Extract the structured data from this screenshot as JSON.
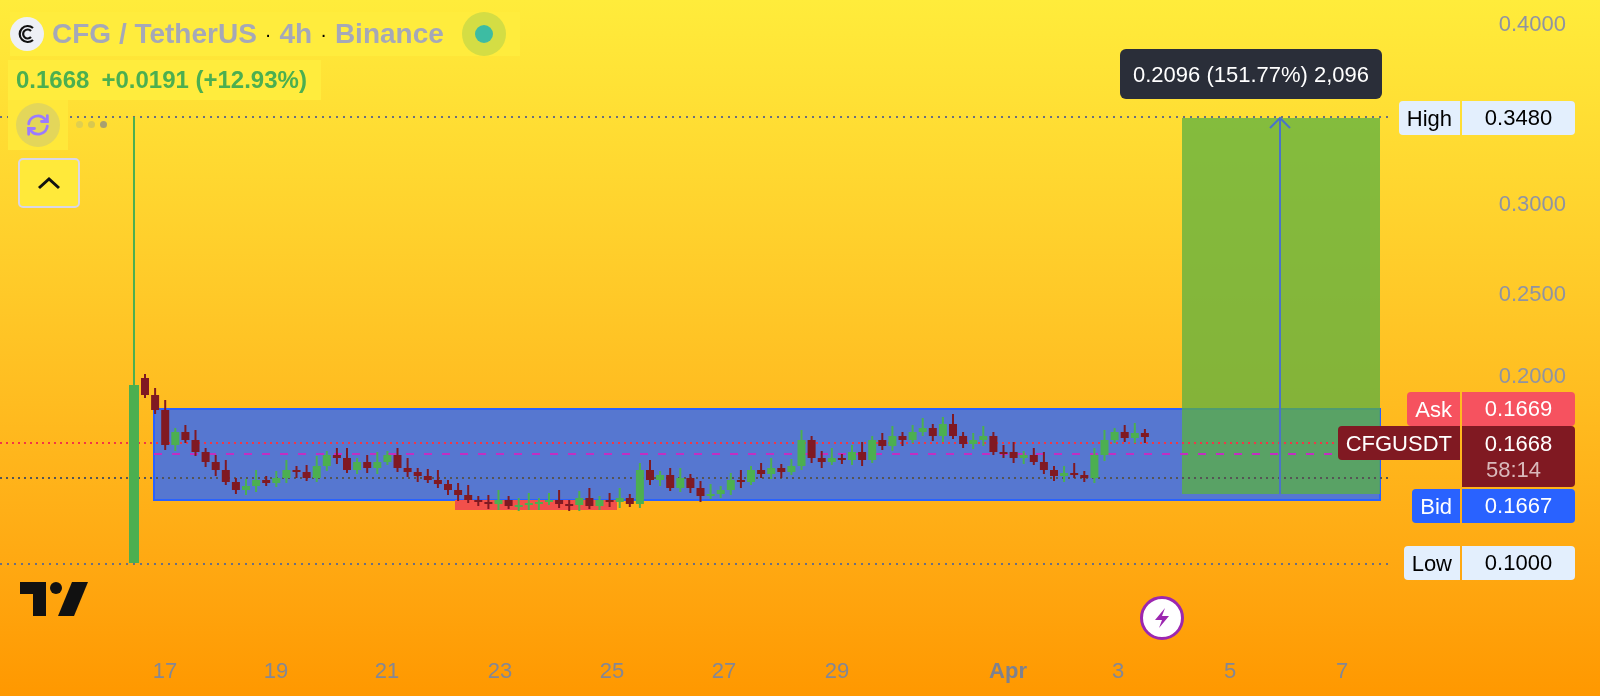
{
  "header": {
    "symbol": "CFG / TetherUS",
    "separator": "·",
    "interval": "4h",
    "exchange": "Binance"
  },
  "quote": {
    "price": "0.1668",
    "change": "+0.0191 (+12.93%)"
  },
  "measure_tooltip": "0.2096 (151.77%) 2,096",
  "price_axis": [
    "0.4000",
    "0.3000",
    "0.2500",
    "0.2000"
  ],
  "price_labels": [
    {
      "kind": "high",
      "label": "High",
      "value": "0.3480"
    },
    {
      "kind": "ask",
      "label": "Ask",
      "value": "0.1669"
    },
    {
      "kind": "last",
      "label": "CFGUSDT",
      "value": "0.1668",
      "countdown": "58:14"
    },
    {
      "kind": "bid",
      "label": "Bid",
      "value": "0.1667"
    },
    {
      "kind": "low",
      "label": "Low",
      "value": "0.1000"
    }
  ],
  "time_axis": [
    {
      "kind": "day",
      "label": "17"
    },
    {
      "kind": "day",
      "label": "19"
    },
    {
      "kind": "day",
      "label": "21"
    },
    {
      "kind": "day",
      "label": "23"
    },
    {
      "kind": "day",
      "label": "25"
    },
    {
      "kind": "day",
      "label": "27"
    },
    {
      "kind": "day",
      "label": "29"
    },
    {
      "kind": "month",
      "label": "Apr"
    },
    {
      "kind": "day",
      "label": "3"
    },
    {
      "kind": "day",
      "label": "5"
    },
    {
      "kind": "day",
      "label": "7"
    }
  ]
}
